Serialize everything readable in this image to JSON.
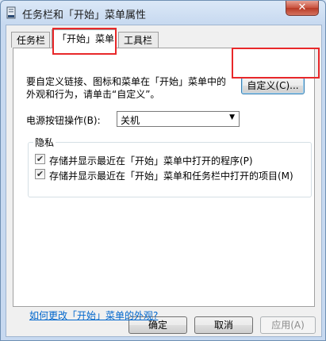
{
  "window": {
    "title": "任务栏和「开始」菜单属性",
    "close_label": "✕"
  },
  "tabs": [
    {
      "label": "任务栏"
    },
    {
      "label": "「开始」菜单"
    },
    {
      "label": "工具栏"
    }
  ],
  "start_menu": {
    "description_line1": "要自定义链接、图标和菜单在「开始」菜单中的",
    "description_line2": "外观和行为，请单击“自定义”。",
    "customize_button": "自定义(C)...",
    "power_label": "电源按钮操作(B):",
    "power_value": "关机",
    "privacy_title": "隐私",
    "privacy_items": [
      {
        "label": "存储并显示最近在「开始」菜单中打开的程序(P)",
        "checked": true
      },
      {
        "label": "存储并显示最近在「开始」菜单和任务栏中打开的项目(M)",
        "checked": true
      }
    ],
    "help_link": "如何更改「开始」菜单的外观?"
  },
  "footer": {
    "ok": "确定",
    "cancel": "取消",
    "apply": "应用(A)"
  },
  "icons": {
    "checkmark": "✔",
    "dropdown": "▼"
  }
}
